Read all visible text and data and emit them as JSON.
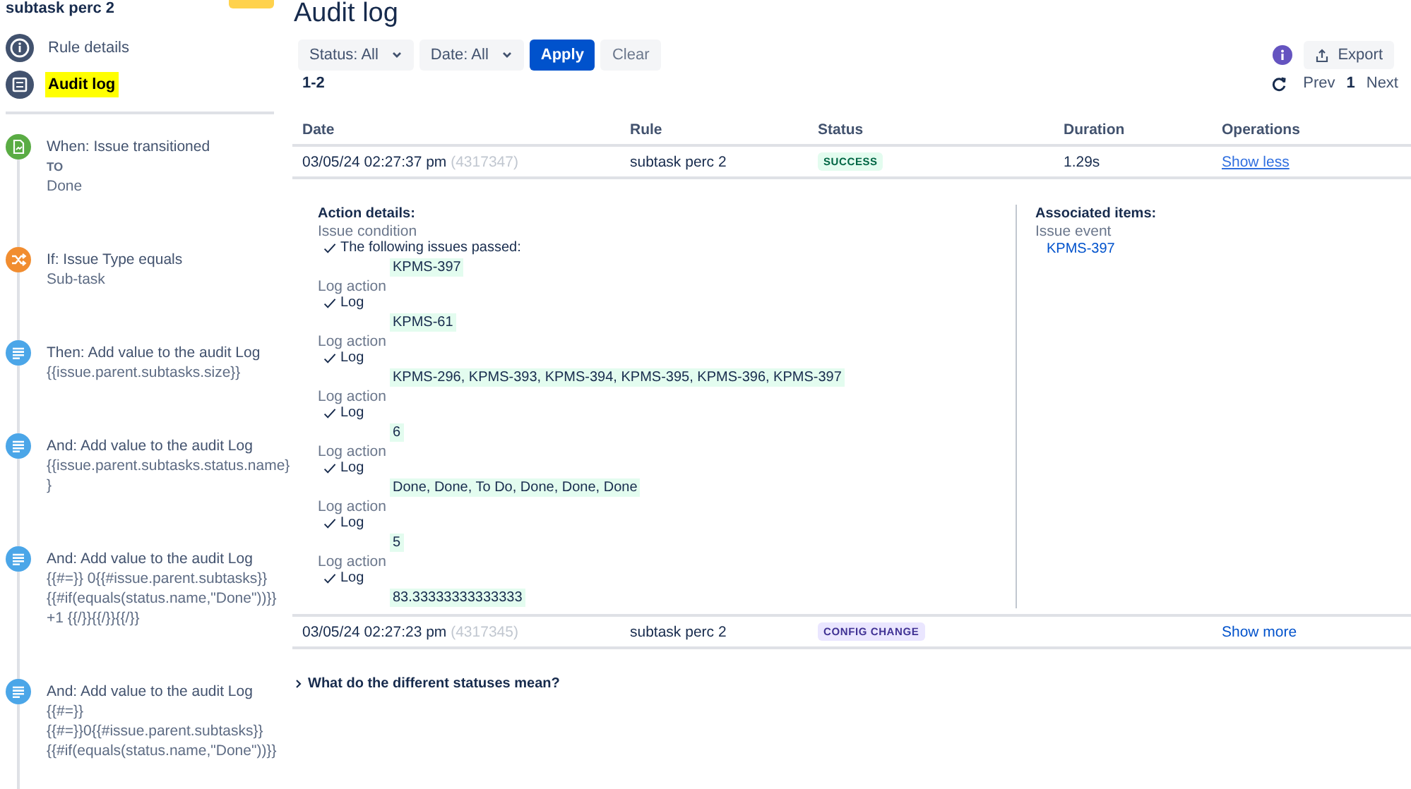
{
  "sidebar": {
    "rule_name": "subtask perc 2",
    "nav": [
      {
        "label": "Rule details",
        "kind": "info",
        "selected": false
      },
      {
        "label": "Audit log",
        "kind": "list",
        "selected": true
      }
    ],
    "steps": [
      {
        "kind": "trigger",
        "title": "When: Issue transitioned",
        "lines": [
          {
            "kind": "label",
            "text": "TO"
          },
          {
            "kind": "value",
            "text": "Done"
          }
        ]
      },
      {
        "kind": "condition",
        "title": "If: Issue Type equals",
        "lines": [
          {
            "kind": "value",
            "text": "Sub-task"
          }
        ]
      },
      {
        "kind": "action",
        "title": "Then: Add value to the audit Log",
        "lines": [
          {
            "kind": "value",
            "text": "{{issue.parent.subtasks.size}}"
          }
        ]
      },
      {
        "kind": "action",
        "title": "And: Add value to the audit Log",
        "lines": [
          {
            "kind": "value",
            "text": "{{issue.parent.subtasks.status.name}"
          },
          {
            "kind": "value",
            "text": "}"
          }
        ]
      },
      {
        "kind": "action",
        "title": "And: Add value to the audit Log",
        "lines": [
          {
            "kind": "value",
            "text": "{{#=}} 0{{#issue.parent.subtasks}}"
          },
          {
            "kind": "value",
            "text": "{{#if(equals(status.name,\"Done\"))}}"
          },
          {
            "kind": "value",
            "text": "+1 {{/}}{{/}}{{/}}"
          }
        ]
      },
      {
        "kind": "action",
        "title": "And: Add value to the audit Log",
        "lines": [
          {
            "kind": "value",
            "text": "{{#=}}"
          },
          {
            "kind": "value",
            "text": "{{#=}}0{{#issue.parent.subtasks}}"
          },
          {
            "kind": "value",
            "text": "{{#if(equals(status.name,\"Done\"))}}"
          }
        ]
      }
    ]
  },
  "main": {
    "title": "Audit log",
    "filters": [
      {
        "label": "Status: All"
      },
      {
        "label": "Date: All"
      }
    ],
    "apply": "Apply",
    "clear": "Clear",
    "export": "Export",
    "range": "1-2",
    "pagination": {
      "prev": "Prev",
      "page": "1",
      "next": "Next"
    },
    "table": {
      "columns": [
        "Date",
        "Rule",
        "Status",
        "Duration",
        "Operations"
      ],
      "rows": [
        {
          "date": "03/05/24 02:27:37 pm",
          "id": "(4317347)",
          "rule": "subtask perc 2",
          "status": "SUCCESS",
          "kind": "success",
          "duration": "1.29s",
          "operation": "Show less",
          "expanded": true,
          "details": {
            "title": "Action details:",
            "groups": [
              {
                "label": "Issue condition",
                "result": "The following issues passed:",
                "value": "KPMS-397"
              },
              {
                "label": "Log action",
                "result": "Log",
                "value": "KPMS-61"
              },
              {
                "label": "Log action",
                "result": "Log",
                "value": "KPMS-296, KPMS-393, KPMS-394, KPMS-395, KPMS-396, KPMS-397"
              },
              {
                "label": "Log action",
                "result": "Log",
                "value": "6"
              },
              {
                "label": "Log action",
                "result": "Log",
                "value": "Done, Done, To Do, Done, Done, Done"
              },
              {
                "label": "Log action",
                "result": "Log",
                "value": "5"
              },
              {
                "label": "Log action",
                "result": "Log",
                "value": "83.33333333333333"
              }
            ]
          },
          "associated": {
            "title": "Associated items:",
            "groups": [
              {
                "label": "Issue event",
                "links": [
                  "KPMS-397"
                ]
              }
            ]
          }
        },
        {
          "date": "03/05/24 02:27:23 pm",
          "id": "(4317345)",
          "rule": "subtask perc 2",
          "status": "CONFIG CHANGE",
          "kind": "config",
          "operation": "Show more",
          "expanded": false
        }
      ]
    },
    "faq": {
      "label": "What do the different statuses mean?",
      "expanded": false
    }
  }
}
